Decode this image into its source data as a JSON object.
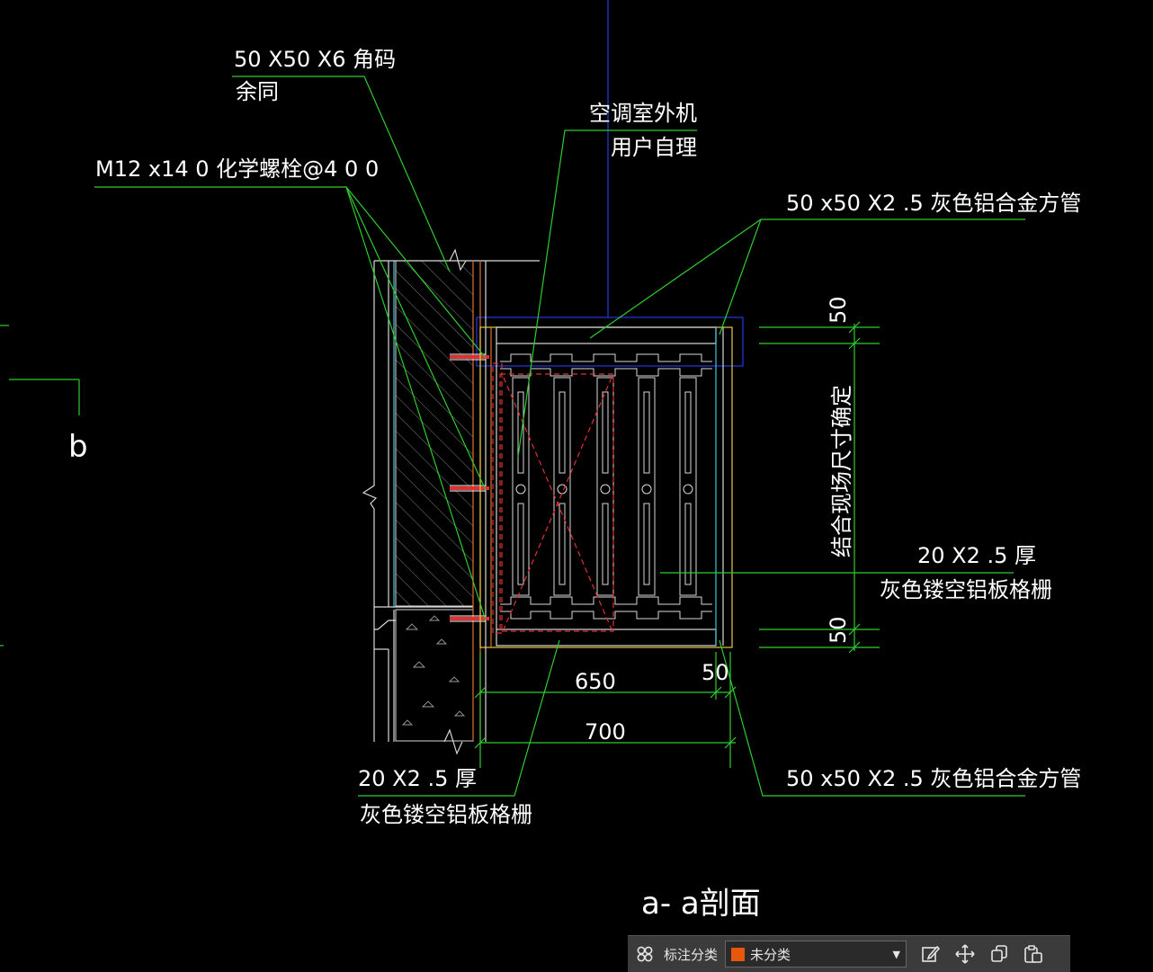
{
  "drawing": {
    "labels": {
      "angle_code": "50 X50 X6 角码",
      "angle_code_note": "余同",
      "bolt": "M12 x14 0 化学螺栓@4 0 0",
      "ac_unit": "空调室外机",
      "ac_unit_note": "用户自理",
      "top_tube": "50 x50 X2 .5 灰色铝合金方管",
      "bottom_tube": "50 x50 X2 .5 灰色铝合金方管",
      "grille_right": "20 X2 .5 厚",
      "grille_right_note": "灰色镂空铝板格栅",
      "grille_left": "20 X2 .5 厚",
      "grille_left_note": "灰色镂空铝板格栅",
      "site_measure": "结合现场尺寸确定",
      "section_marker": "b",
      "section_title": "a- a剖面"
    },
    "dimensions": {
      "top_50": "50",
      "bottom_50": "50",
      "width_650": "650",
      "width_50": "50",
      "width_700": "700"
    },
    "colors": {
      "background": "#000000",
      "leader": "#2ecc2e",
      "outline": "#d9d9d9",
      "frame": "#e8c84a",
      "insulation": "#3fc3d8",
      "wall_face": "#e07030",
      "unit_outline": "#e03030",
      "selection": "#2030c8"
    }
  },
  "toolbar": {
    "grid_icon": "grid-icon",
    "category_label": "标注分类",
    "category_value": "未分类",
    "category_color": "#e8580c",
    "edit_icon": "edit-icon",
    "move_icon": "move-icon",
    "copy_icon": "copy-icon",
    "paste_icon": "paste-icon"
  }
}
